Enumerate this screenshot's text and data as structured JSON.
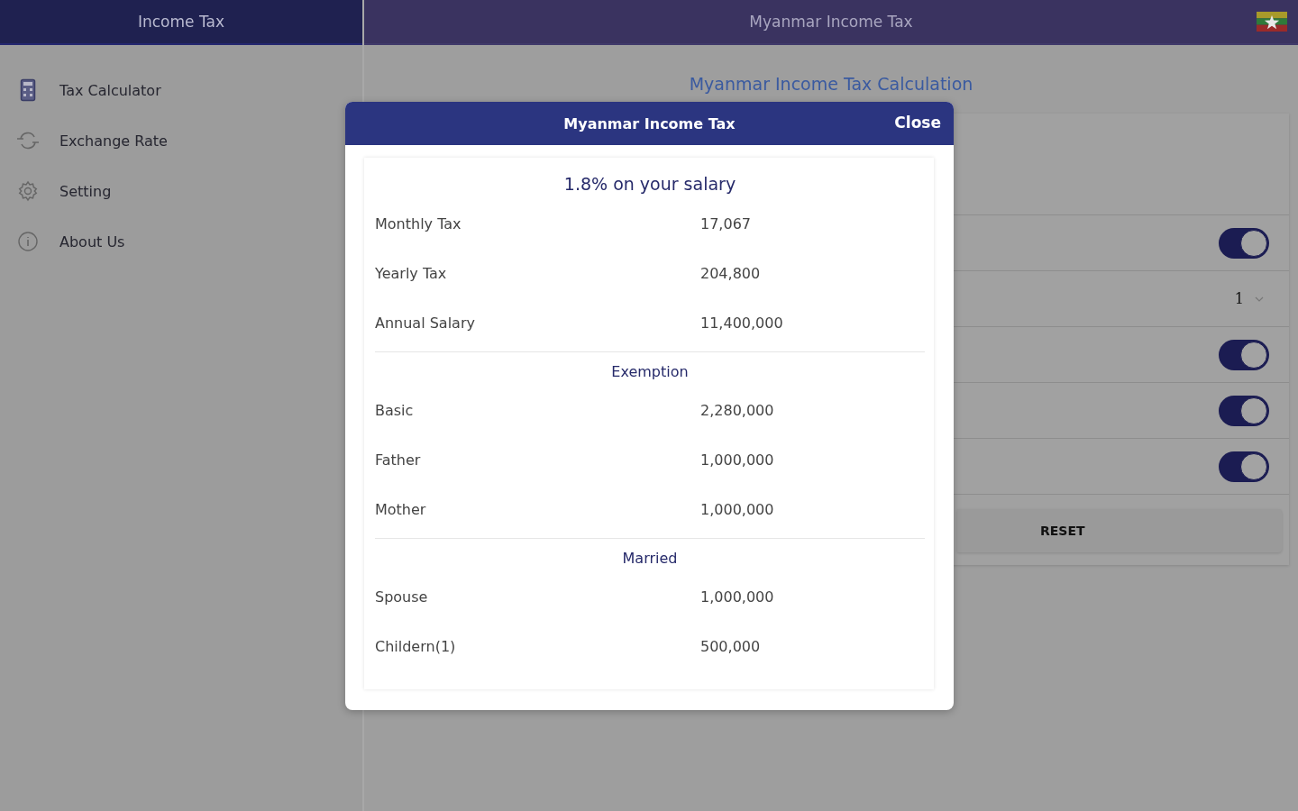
{
  "sidebar": {
    "title": "Income Tax",
    "items": [
      {
        "label": "Tax Calculator"
      },
      {
        "label": "Exchange Rate"
      },
      {
        "label": "Setting"
      },
      {
        "label": "About Us"
      }
    ]
  },
  "header": {
    "title": "Myanmar Income Tax"
  },
  "calculator": {
    "heading": "Myanmar Income Tax Calculation",
    "rows": [
      {
        "kind": "toggle",
        "on": true
      },
      {
        "kind": "select",
        "value": "1"
      },
      {
        "kind": "toggle",
        "on": true
      },
      {
        "kind": "toggle",
        "on": true
      },
      {
        "kind": "toggle",
        "on": true
      }
    ],
    "reset": "RESET"
  },
  "dialog": {
    "title": "Myanmar Income Tax",
    "close": "Close",
    "headline": "1.8% on your salary",
    "sections": [
      {
        "rows": [
          {
            "label": "Monthly Tax",
            "value": "17,067"
          },
          {
            "label": "Yearly Tax",
            "value": "204,800"
          },
          {
            "label": "Annual Salary",
            "value": "11,400,000"
          }
        ]
      },
      {
        "heading": "Exemption",
        "rows": [
          {
            "label": "Basic",
            "value": "2,280,000"
          },
          {
            "label": "Father",
            "value": "1,000,000"
          },
          {
            "label": "Mother",
            "value": "1,000,000"
          }
        ]
      },
      {
        "heading": "Married",
        "rows": [
          {
            "label": "Spouse",
            "value": "1,000,000"
          },
          {
            "label": "Childern(1)",
            "value": "500,000"
          }
        ]
      }
    ]
  }
}
